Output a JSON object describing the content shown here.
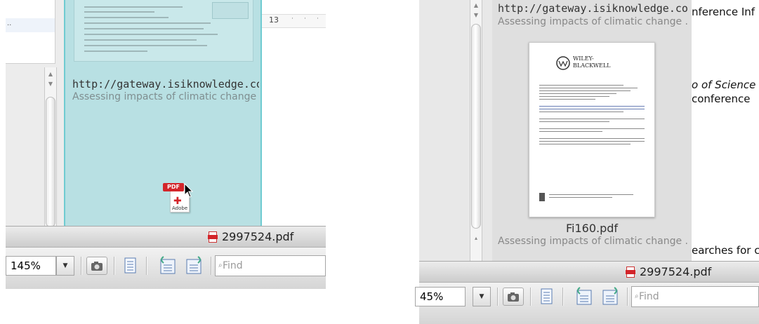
{
  "left_panel": {
    "ruler_number": "13",
    "file_item": {
      "title": "http://gateway.isiknowledge.co...",
      "subtitle": "Assessing impacts of climatic change ..."
    },
    "drag_icon_label": "PDF",
    "drag_icon_brand": "Adobe",
    "status_file": "2997524.pdf",
    "zoom": "145%",
    "find_placeholder": "Find"
  },
  "right_panel": {
    "file_item_top": {
      "title": "http://gateway.isiknowledge.co...",
      "subtitle": "Assessing impacts of climatic change ..."
    },
    "thumbnail_logo_line1": "WILEY-",
    "thumbnail_logo_line2": "BLACKWELL",
    "file_item_bottom": {
      "title": "Fi160.pdf",
      "subtitle": "Assessing impacts of climatic change ..."
    },
    "doc_text": {
      "line1": "nference Inf",
      "line2": "o of Science",
      "line3": "conference",
      "line4": "earches for c"
    },
    "status_file": "2997524.pdf",
    "zoom": "45%",
    "find_placeholder": "Find"
  },
  "icons": [
    "camera-icon",
    "page-icon",
    "import-icon",
    "export-icon",
    "pdf-file-icon",
    "cursor-arrow-icon",
    "wiley-logo-icon",
    "search-icon"
  ],
  "colors": {
    "selection_fill": "#b8e0e3",
    "selection_border": "#6fcbd1",
    "pdf_red": "#d3252a",
    "link_text": "#333333",
    "subtitle_text": "#888888"
  }
}
